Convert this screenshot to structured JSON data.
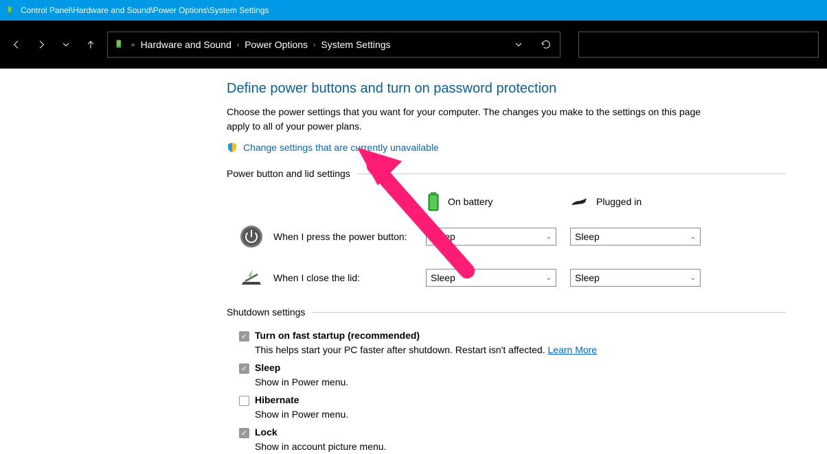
{
  "titlebar": {
    "path": "Control Panel\\Hardware and Sound\\Power Options\\System Settings"
  },
  "breadcrumb": {
    "items": [
      "Hardware and Sound",
      "Power Options",
      "System Settings"
    ]
  },
  "page": {
    "heading": "Define power buttons and turn on password protection",
    "description": "Choose the power settings that you want for your computer. The changes you make to the settings on this page apply to all of your power plans.",
    "change_link": "Change settings that are currently unavailable"
  },
  "sections": {
    "power_lid": {
      "title": "Power button and lid settings",
      "columns": {
        "battery": "On battery",
        "plugged": "Plugged in"
      },
      "rows": [
        {
          "label": "When I press the power button:",
          "battery": "Sleep",
          "plugged": "Sleep"
        },
        {
          "label": "When I close the lid:",
          "battery": "Sleep",
          "plugged": "Sleep"
        }
      ]
    },
    "shutdown": {
      "title": "Shutdown settings",
      "items": [
        {
          "checked": true,
          "label": "Turn on fast startup (recommended)",
          "sub": "This helps start your PC faster after shutdown. Restart isn't affected.",
          "link": "Learn More"
        },
        {
          "checked": true,
          "label": "Sleep",
          "sub": "Show in Power menu."
        },
        {
          "checked": false,
          "label": "Hibernate",
          "sub": "Show in Power menu."
        },
        {
          "checked": true,
          "label": "Lock",
          "sub": "Show in account picture menu."
        }
      ]
    }
  }
}
